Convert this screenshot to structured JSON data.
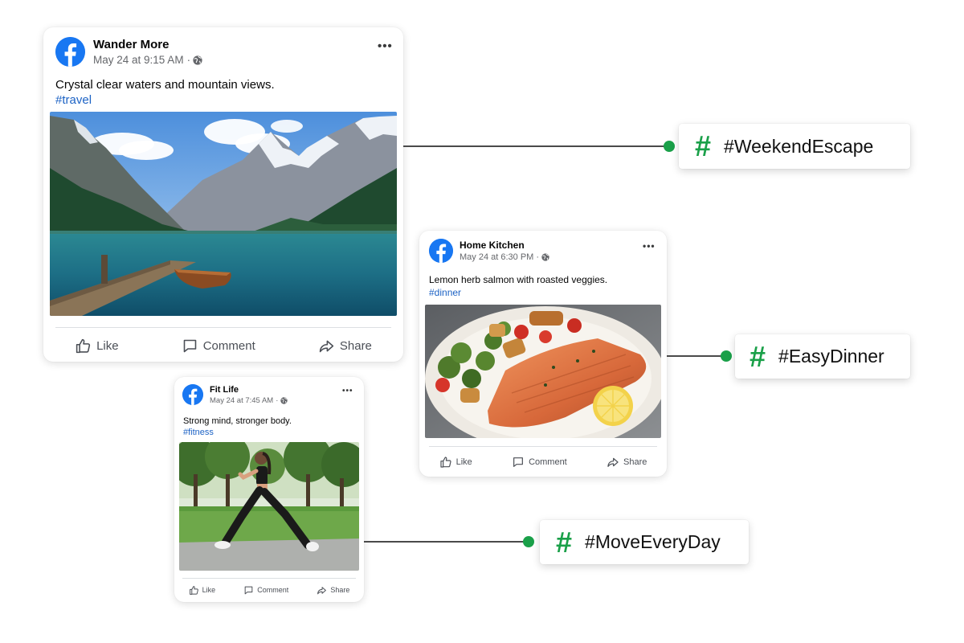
{
  "posts": [
    {
      "id": "travel",
      "author": "Wander More",
      "timestamp": "May 24 at 9:15 AM",
      "separator": "·",
      "caption": "Crystal clear waters and mountain views.",
      "hashtag": "#travel",
      "image_subject": "mountain lake with wooden dock and rowboat",
      "actions": {
        "like": "Like",
        "comment": "Comment",
        "share": "Share"
      }
    },
    {
      "id": "dinner",
      "author": "Home Kitchen",
      "timestamp": "May 24 at 6:30 PM",
      "separator": "·",
      "caption": "Lemon herb salmon with roasted veggies.",
      "hashtag": "#dinner",
      "image_subject": "salmon fillet with roasted vegetables and lemon",
      "actions": {
        "like": "Like",
        "comment": "Comment",
        "share": "Share"
      }
    },
    {
      "id": "fitness",
      "author": "Fit Life",
      "timestamp": "May 24 at 7:45 AM",
      "separator": "·",
      "caption": "Strong mind, stronger body.",
      "hashtag": "#fitness",
      "image_subject": "woman doing a lunge in a park",
      "actions": {
        "like": "Like",
        "comment": "Comment",
        "share": "Share"
      }
    }
  ],
  "campaign_tags": [
    {
      "symbol": "#",
      "text": "#WeekendEscape"
    },
    {
      "symbol": "#",
      "text": "#EasyDinner"
    },
    {
      "symbol": "#",
      "text": "#MoveEveryDay"
    }
  ],
  "colors": {
    "facebook_blue": "#1877f2",
    "hashtag_link": "#1d63c5",
    "accent_green": "#1aa049"
  },
  "icons": [
    "facebook-logo-icon",
    "globe-icon",
    "more-options-icon",
    "like-icon",
    "comment-icon",
    "share-icon",
    "hashtag-icon"
  ]
}
